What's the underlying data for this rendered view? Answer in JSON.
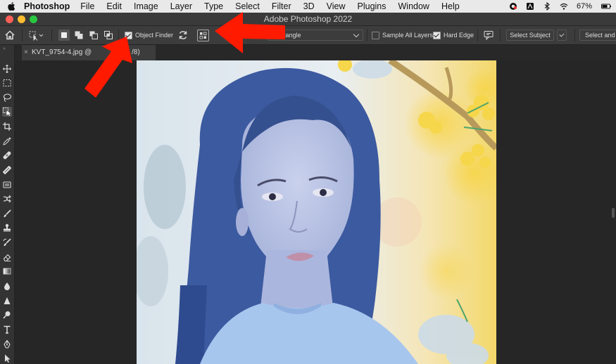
{
  "menubar": {
    "app_name": "Photoshop",
    "items": [
      "File",
      "Edit",
      "Image",
      "Layer",
      "Type",
      "Select",
      "Filter",
      "3D",
      "View",
      "Plugins",
      "Window",
      "Help"
    ],
    "battery": "67%"
  },
  "window": {
    "title": "Adobe Photoshop 2022"
  },
  "options_bar": {
    "object_finder_label": "Object Finder",
    "object_finder_checked": true,
    "mode_value": "Rectangle",
    "sample_all_layers_label": "Sample All Layers",
    "sample_all_layers_checked": false,
    "hard_edge_label": "Hard Edge",
    "hard_edge_checked": true,
    "select_subject_label": "Select Subject",
    "select_and_mask_label": "Select and"
  },
  "document": {
    "tab_title": "KVT_9754-4.jpg @ ",
    "tab_suffix": "/8)"
  },
  "tools": [
    "move",
    "marquee",
    "lasso",
    "object-selection",
    "crop",
    "eyedropper",
    "spot-healing",
    "brush",
    "clone-stamp",
    "history-brush",
    "eraser",
    "gradient",
    "blur",
    "dodge",
    "pen",
    "type",
    "path-selection"
  ],
  "colors": {
    "annotation_arrow": "#ff1a00",
    "selection_overlay": "#3c5aa0"
  }
}
